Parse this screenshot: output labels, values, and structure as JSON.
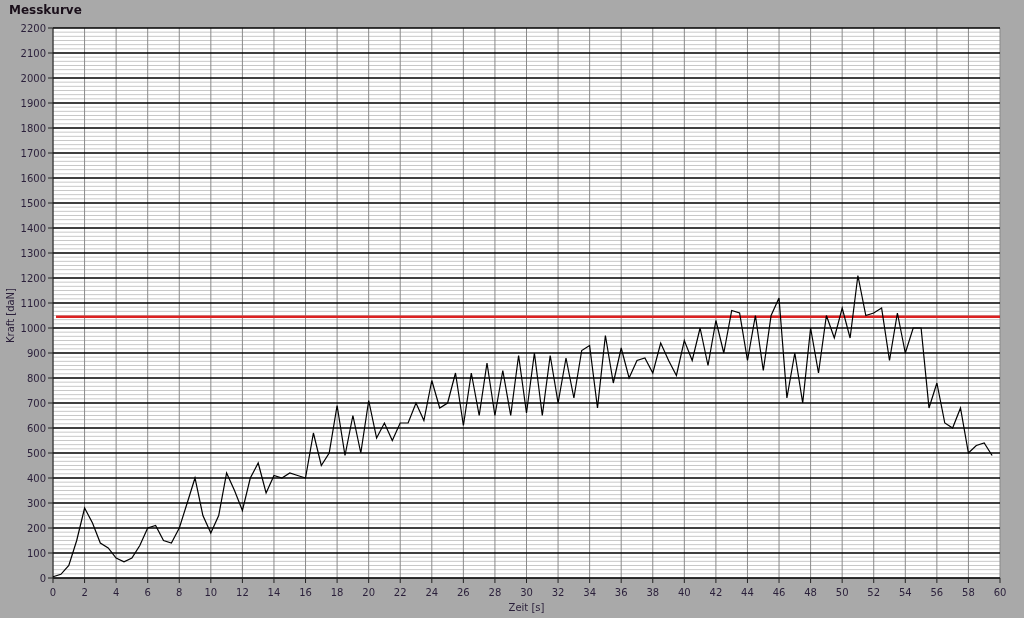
{
  "panel": {
    "title": "Messkurve",
    "chart_data": {
      "type": "line",
      "grid": true,
      "xlabel": "Zeit [s]",
      "ylabel": "Kraft [daN]",
      "xlim": [
        0,
        60
      ],
      "ylim": [
        0,
        2200
      ],
      "xticks": [
        0,
        2,
        4,
        6,
        8,
        10,
        12,
        14,
        16,
        18,
        20,
        22,
        24,
        26,
        28,
        30,
        32,
        34,
        36,
        38,
        40,
        42,
        44,
        46,
        48,
        50,
        52,
        54,
        56,
        58,
        60
      ],
      "yticks": [
        0,
        100,
        200,
        300,
        400,
        500,
        600,
        700,
        800,
        900,
        1000,
        1100,
        1200,
        1300,
        1400,
        1500,
        1600,
        1700,
        1800,
        1900,
        2000,
        2100,
        2200
      ],
      "x": [
        0,
        0.5,
        1,
        1.5,
        2,
        2.5,
        3,
        3.5,
        4,
        4.5,
        5,
        5.5,
        6,
        6.5,
        7,
        7.5,
        8,
        8.5,
        9,
        9.5,
        10,
        10.5,
        11,
        11.5,
        12,
        12.5,
        13,
        13.5,
        14,
        14.5,
        15,
        15.5,
        16,
        16.5,
        17,
        17.5,
        18,
        18.5,
        19,
        19.5,
        20,
        20.5,
        21,
        21.5,
        22,
        22.5,
        23,
        23.5,
        24,
        24.5,
        25,
        25.5,
        26,
        26.5,
        27,
        27.5,
        28,
        28.5,
        29,
        29.5,
        30,
        30.5,
        31,
        31.5,
        32,
        32.5,
        33,
        33.5,
        34,
        34.5,
        35,
        35.5,
        36,
        36.5,
        37,
        37.5,
        38,
        38.5,
        39,
        39.5,
        40,
        40.5,
        41,
        41.5,
        42,
        42.5,
        43,
        43.5,
        44,
        44.5,
        45,
        45.5,
        46,
        46.5,
        47,
        47.5,
        48,
        48.5,
        49,
        49.5,
        50,
        50.5,
        51,
        51.5,
        52,
        52.5,
        53,
        53.5,
        54,
        54.5,
        55,
        55.5,
        56,
        56.5,
        57,
        57.5,
        58,
        58.5,
        59,
        59.5
      ],
      "series": [
        {
          "color": "#000000",
          "values": [
            5,
            15,
            50,
            150,
            280,
            220,
            140,
            120,
            80,
            65,
            80,
            130,
            200,
            210,
            150,
            140,
            200,
            300,
            400,
            250,
            180,
            250,
            420,
            350,
            270,
            400,
            460,
            340,
            410,
            400,
            420,
            410,
            400,
            580,
            450,
            500,
            690,
            490,
            650,
            500,
            710,
            560,
            620,
            550,
            620,
            620,
            700,
            630,
            790,
            680,
            700,
            820,
            610,
            820,
            650,
            860,
            650,
            830,
            650,
            890,
            660,
            900,
            650,
            890,
            700,
            880,
            720,
            910,
            930,
            680,
            970,
            780,
            920,
            800,
            870,
            880,
            820,
            940,
            870,
            810,
            950,
            870,
            1000,
            850,
            1030,
            900,
            1070,
            1060,
            870,
            1050,
            830,
            1050,
            1120,
            720,
            900,
            700,
            1000,
            820,
            1050,
            960,
            1080,
            960,
            1210,
            1050,
            1060,
            1080,
            870,
            1060,
            900,
            1000,
            1000,
            680,
            780,
            620,
            600,
            680,
            500,
            530,
            540,
            490
          ]
        }
      ],
      "ref_lines": [
        {
          "axis": "y",
          "value": 1045,
          "color": "#dd2222"
        }
      ]
    }
  }
}
